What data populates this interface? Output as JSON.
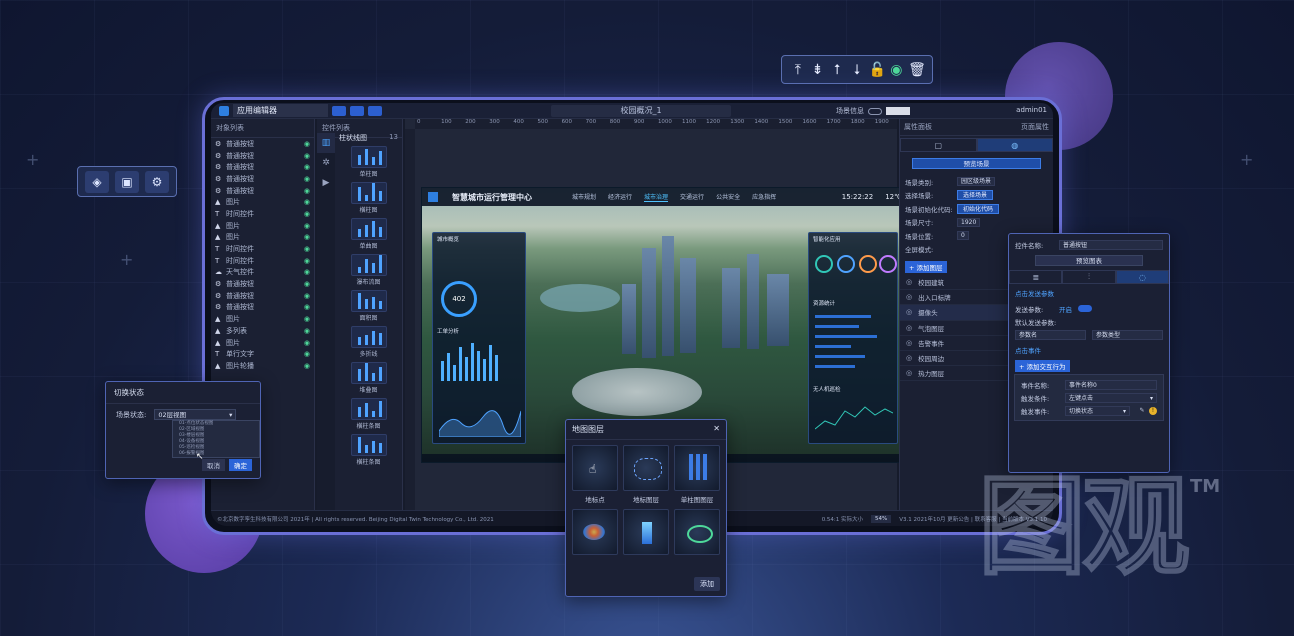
{
  "floating_toolbar": {
    "icons": [
      "align-top-icon",
      "align-vcenter-icon",
      "align-up-icon",
      "align-down-icon",
      "lock-icon",
      "eye-icon",
      "trash-icon"
    ]
  },
  "side_toolbar": {
    "icons": [
      "layers-icon",
      "save-icon",
      "settings-icon"
    ]
  },
  "app": {
    "name": "应用编辑器",
    "document_name": "校园概况_1",
    "scene_info_label": "场景信息",
    "user": "admin01"
  },
  "layer_panel": {
    "title": "对象列表",
    "items": [
      {
        "icon": "⚙",
        "label": "普通按钮"
      },
      {
        "icon": "⚙",
        "label": "普通按钮"
      },
      {
        "icon": "⚙",
        "label": "普通按钮"
      },
      {
        "icon": "⚙",
        "label": "普通按钮"
      },
      {
        "icon": "⚙",
        "label": "普通按钮"
      },
      {
        "icon": "▲",
        "label": "图片"
      },
      {
        "icon": "T",
        "label": "时间控件"
      },
      {
        "icon": "▲",
        "label": "图片"
      },
      {
        "icon": "▲",
        "label": "图片"
      },
      {
        "icon": "T",
        "label": "时间控件"
      },
      {
        "icon": "T",
        "label": "时间控件"
      },
      {
        "icon": "☁",
        "label": "天气控件"
      },
      {
        "icon": "⚙",
        "label": "普通按钮"
      },
      {
        "icon": "⚙",
        "label": "普通按钮"
      },
      {
        "icon": "⚙",
        "label": "普通按钮"
      },
      {
        "icon": "▲",
        "label": "图片"
      },
      {
        "icon": "▲",
        "label": "多列表"
      },
      {
        "icon": "▲",
        "label": "图片"
      }
    ],
    "bottom_items": [
      {
        "icon": "T",
        "label": "单行文字"
      },
      {
        "icon": "▲",
        "label": "图片轮播"
      }
    ]
  },
  "component_panel": {
    "title": "控件列表",
    "group": "柱状线图",
    "group_count": "13",
    "items": [
      "单柱图",
      "横柱图",
      "单曲图",
      "瀑布流图",
      "面积图",
      "多折线",
      "堆叠图",
      "横柱条图",
      "横柱条图"
    ]
  },
  "ruler": {
    "ticks": [
      "0",
      "100",
      "200",
      "300",
      "400",
      "500",
      "600",
      "700",
      "800",
      "900",
      "1000",
      "1100",
      "1200",
      "1300",
      "1400",
      "1500",
      "1600",
      "1700",
      "1800",
      "1900"
    ]
  },
  "dashboard": {
    "title": "智慧城市运行管理中心",
    "nav": [
      "城市规划",
      "经济运行",
      "城市治理",
      "交通运行",
      "公共安全",
      "应急指挥"
    ],
    "active_nav": "城市治理",
    "time": "15:22:22",
    "temp": "12℃",
    "gauge_value": "402",
    "left_card_title": "城市概览",
    "left_card2_title": "工单分析",
    "right_card_title": "智能化应用",
    "right_card2_title": "资源统计",
    "right_card3_title": "无人机巡检"
  },
  "props_panel": {
    "title": "属性面板",
    "right_title": "页面属性",
    "preview_label": "预览场景",
    "rows": [
      {
        "label": "场景类别:",
        "value": "园区级场景"
      },
      {
        "label": "选择场景:",
        "button": "选择场景"
      },
      {
        "label": "场景初始化代码:",
        "button": "初始化代码"
      },
      {
        "label": "场景尺寸:",
        "value": "1920"
      },
      {
        "label": "场景位置:",
        "value": "0"
      },
      {
        "label": "全屏模式:"
      }
    ],
    "add_layer": "+ 添加图层",
    "layers": [
      "校园建筑",
      "出入口标牌",
      "摄像头",
      "气泡图层",
      "告警事件",
      "校园周边",
      "热力图层"
    ],
    "active_layer": "摄像头"
  },
  "statusbar": {
    "copyright": "©北京数字孪生科技有限公司 2021年 | All rights reserved. Beijing Digital Twin Technology Co., Ltd. 2021",
    "ratio": "0.54:1 实际大小",
    "zoom": "54%",
    "version": "V3.1 2021年10月 更新公告 | 联系客服 | 当前版本 V3.1.10"
  },
  "switch_popup": {
    "title": "切换状态",
    "label": "场景状态:",
    "selected": "02层视图",
    "options": [
      "01-点位状态视图",
      "02-区域视图",
      "03-楼层视图",
      "04-设备视图",
      "05-巡检视图",
      "06-报警视图"
    ],
    "cancel": "取消",
    "ok": "确定"
  },
  "map_popup": {
    "title": "地图图层",
    "row1_labels": [
      "地标点",
      "地标图层",
      "单柱图图层"
    ],
    "add_button": "添加"
  },
  "event_popup": {
    "name_label": "控件名称:",
    "name_value": "普通按钮",
    "preview_button": "预览图表",
    "section_title": "点击发送参数",
    "send_label": "发送参数:",
    "send_state": "开启",
    "default_label": "默认发送参数:",
    "param_name": "参数名",
    "param_value": "参数类型",
    "event_section": "点击事件",
    "add_action": "+ 添加交互行为",
    "event_name_label": "事件名称:",
    "event_name_value": "事件名称0",
    "trigger_label": "触发条件:",
    "trigger_value": "左键点击",
    "trigger_event_label": "触发事件:",
    "trigger_event_value": "切换状态"
  },
  "watermark": {
    "text": "图观",
    "tm": "TM"
  }
}
